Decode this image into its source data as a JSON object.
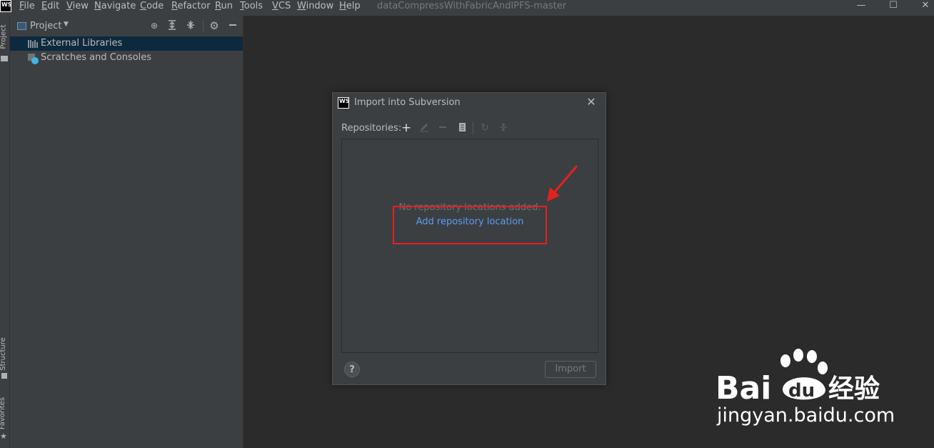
{
  "menubar": {
    "items": [
      "File",
      "Edit",
      "View",
      "Navigate",
      "Code",
      "Refactor",
      "Run",
      "Tools",
      "VCS",
      "Window",
      "Help"
    ],
    "project_title": "dataCompressWithFabricAndIPFS-master",
    "app_logo": "WS",
    "window_buttons": {
      "minimize": "—",
      "maximize": "☐",
      "close": "✕"
    }
  },
  "left_stripe": {
    "tabs": [
      "Project",
      "Structure",
      "Favorites"
    ]
  },
  "project_panel": {
    "title": "Project",
    "chevron": "▼",
    "toolbar_icons": [
      "locate-icon",
      "expand-all-icon",
      "collapse-all-icon",
      "gear-icon",
      "minimize-icon"
    ],
    "tree": [
      {
        "label": "External Libraries",
        "icon": "library-icon",
        "selected": true
      },
      {
        "label": "Scratches and Consoles",
        "icon": "scratches-icon",
        "selected": false
      }
    ]
  },
  "dialog": {
    "logo": "WS",
    "title": "Import into Subversion",
    "close": "✕",
    "repositories_label": "Repositories:",
    "toolbar_icons": [
      "add-icon",
      "edit-icon",
      "remove-icon",
      "browse-icon",
      "refresh-icon",
      "collapse-icon"
    ],
    "empty_text": "No repository locations added.",
    "add_link": "Add repository location",
    "help": "?",
    "import_button": "Import"
  },
  "annotation": {
    "highlight_color": "#e81f1f"
  },
  "watermark": {
    "brand": "Bai du 经验",
    "url": "jingyan.baidu.com"
  },
  "colors": {
    "background": "#2b2b2b",
    "panel": "#3c3f41",
    "selection": "#0d293e",
    "link": "#589df6"
  }
}
